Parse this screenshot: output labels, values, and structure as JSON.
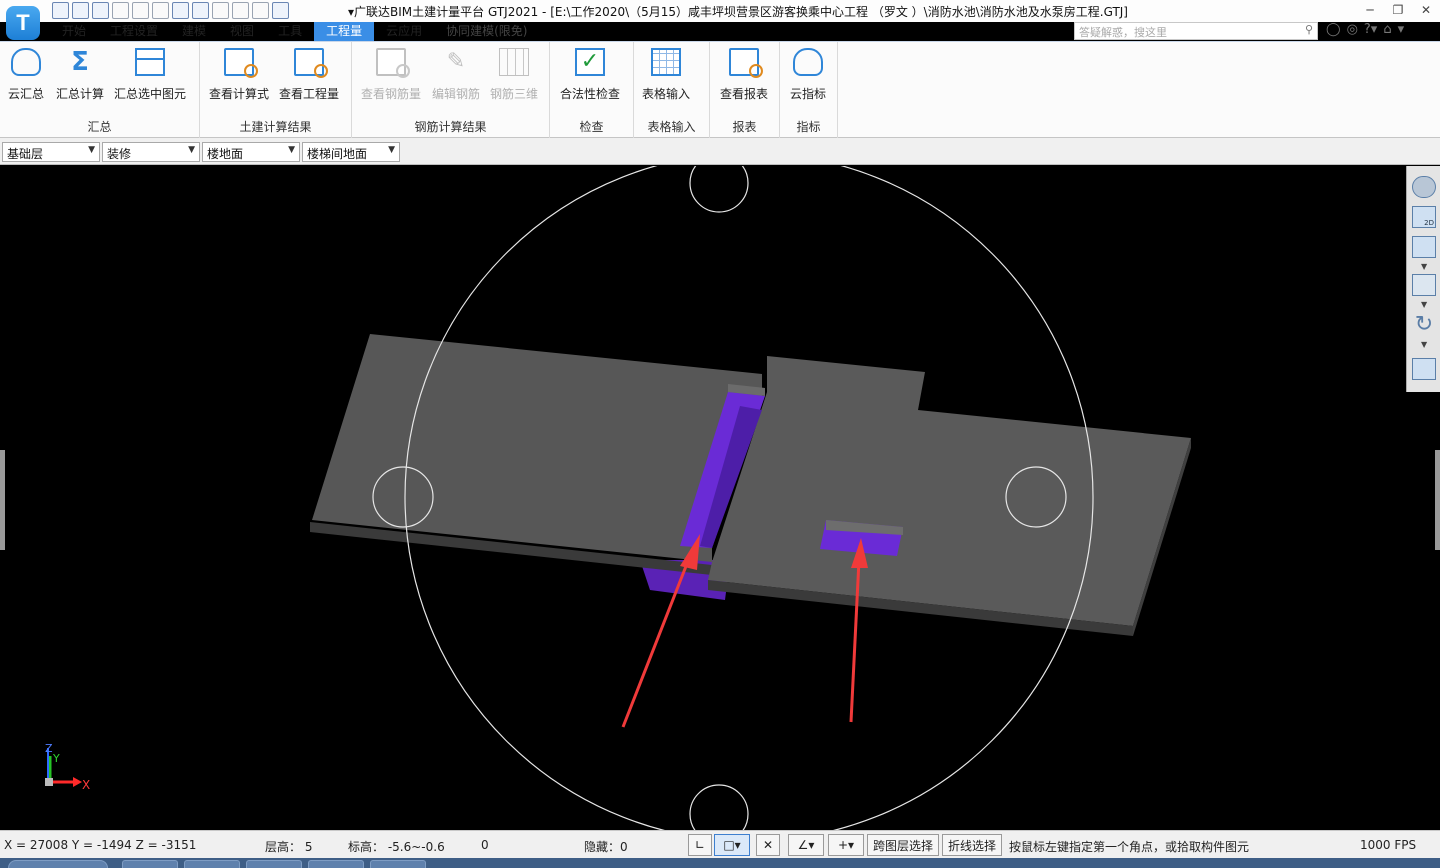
{
  "window": {
    "title": "▾广联达BIM土建计量平台 GTJ2021 - [E:\\工作2020\\（5月15）咸丰坪坝营景区游客换乘中心工程 （罗文 ）\\消防水池\\消防水池及水泵房工程.GTJ]",
    "app_icon_letter": "T",
    "help_search_placeholder": "答疑解惑，搜这里",
    "controls": {
      "minimize": "─",
      "restore": "❐",
      "close": "✕"
    },
    "user_icons": [
      "◯",
      "◎",
      "?▾",
      "⌂",
      "▾"
    ]
  },
  "menu": {
    "items": [
      {
        "label": "开始",
        "active": false
      },
      {
        "label": "工程设置",
        "active": false
      },
      {
        "label": "建模",
        "active": false
      },
      {
        "label": "视图",
        "active": false
      },
      {
        "label": "工具",
        "active": false
      },
      {
        "label": "工程量",
        "active": true
      },
      {
        "label": "云应用",
        "active": false
      },
      {
        "label": "协同建模(限免)",
        "active": false
      }
    ]
  },
  "ribbon": {
    "groups": [
      {
        "label": "汇总",
        "buttons": [
          {
            "label": "云汇总",
            "icon": "cloud-sum-icon",
            "enabled": true
          },
          {
            "label": "汇总计算",
            "icon": "sigma-icon",
            "enabled": true
          },
          {
            "label": "汇总选中图元",
            "icon": "grid-select-icon",
            "enabled": true
          }
        ]
      },
      {
        "label": "土建计算结果",
        "buttons": [
          {
            "label": "查看计算式",
            "icon": "formula-search-icon",
            "enabled": true
          },
          {
            "label": "查看工程量",
            "icon": "quantity-search-icon",
            "enabled": true
          }
        ]
      },
      {
        "label": "钢筋计算结果",
        "buttons": [
          {
            "label": "查看钢筋量",
            "icon": "rebar-quantity-icon",
            "enabled": false
          },
          {
            "label": "编辑钢筋",
            "icon": "edit-rebar-icon",
            "enabled": false
          },
          {
            "label": "钢筋三维",
            "icon": "rebar-3d-icon",
            "enabled": false
          }
        ]
      },
      {
        "label": "检查",
        "buttons": [
          {
            "label": "合法性检查",
            "icon": "validity-check-icon",
            "enabled": true
          }
        ]
      },
      {
        "label": "表格输入",
        "buttons": [
          {
            "label": "表格输入",
            "icon": "table-input-icon",
            "enabled": true
          }
        ]
      },
      {
        "label": "报表",
        "buttons": [
          {
            "label": "查看报表",
            "icon": "report-view-icon",
            "enabled": true
          }
        ]
      },
      {
        "label": "指标",
        "buttons": [
          {
            "label": "云指标",
            "icon": "cloud-index-icon",
            "enabled": true
          }
        ]
      }
    ]
  },
  "filters": {
    "floor": "基础层",
    "category": "装修",
    "component": "楼地面",
    "instance": "楼梯间地面"
  },
  "viewport": {
    "axis_labels": {
      "z": "Z",
      "y": "Y",
      "x": "X"
    },
    "view_toolbar_icons": [
      "orbit-sphere-icon",
      "2d-view-icon",
      "3d-view-icon",
      "box-view-icon",
      "rotate-icon",
      "layer-panel-icon"
    ],
    "view_2d_label": "2D",
    "colors": {
      "slab": "#575757",
      "slab_edge": "#3d3d3d",
      "pit": "#6a2bd6",
      "arrow": "#f03a3a",
      "orbit": "#e6e6e6"
    }
  },
  "status": {
    "coords": "X = 27008 Y = -1494 Z = -3151",
    "floor_height": "层高： 5",
    "elevation": "标高： -5.6~-0.6",
    "count": "0",
    "hidden": "隐藏：0",
    "cross_layer_btn": "跨图层选择",
    "polyline_btn": "折线选择",
    "hint": "按鼠标左键指定第一个角点，或拾取构件图元",
    "fps": "1000 FPS"
  }
}
